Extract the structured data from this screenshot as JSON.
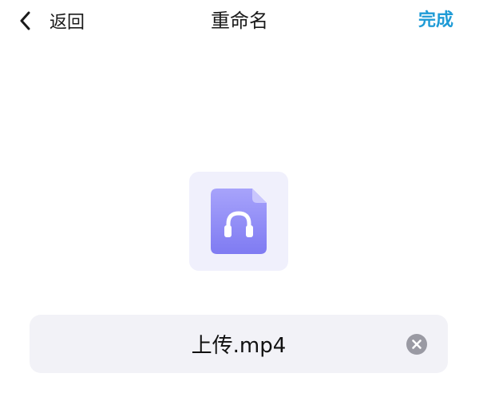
{
  "nav": {
    "back_label": "返回",
    "title": "重命名",
    "done_label": "完成"
  },
  "file": {
    "icon": "audio-file-headphones-icon"
  },
  "rename": {
    "value": "上传.mp4",
    "clear_icon": "clear-circle-x-icon"
  },
  "colors": {
    "accent": "#1f9bd6",
    "file_tile_bg": "#f0f0fc",
    "file_icon": "#8a86f5",
    "input_bg": "#f2f2f7",
    "clear_icon": "#9a9aa3"
  }
}
